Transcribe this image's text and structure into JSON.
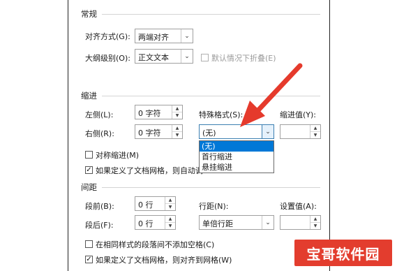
{
  "general": {
    "title": "常规",
    "alignment_label": "对齐方式(G):",
    "alignment_value": "两端对齐",
    "outline_label": "大纲级别(O):",
    "outline_value": "正文文本",
    "collapse_label": "默认情况下折叠(E)"
  },
  "indent": {
    "title": "缩进",
    "left_label": "左侧(L):",
    "left_value": "0 字符",
    "right_label": "右侧(R):",
    "right_value": "0 字符",
    "special_label": "特殊格式(S):",
    "special_value": "(无)",
    "indent_by_label": "缩进值(Y):",
    "indent_by_value": "",
    "mirror_label": "对称缩进(M)",
    "grid_label": "如果定义了文档网格，则自动调",
    "special_options": [
      "(无)",
      "首行缩进",
      "悬挂缩进"
    ]
  },
  "spacing": {
    "title": "间距",
    "before_label": "段前(B):",
    "before_value": "0 行",
    "after_label": "段后(F):",
    "after_value": "0 行",
    "line_spacing_label": "行距(N):",
    "line_spacing_value": "单倍行距",
    "at_label": "设置值(A):",
    "at_value": "",
    "no_space_label": "在相同样式的段落间不添加空格(C)",
    "snap_grid_label": "如果定义了文档网格，则对齐到网格(W)"
  },
  "watermark": "宝哥软件园",
  "colors": {
    "arrow": "#e53a2c",
    "selection": "#0078d7",
    "watermark_bg": "#e33d2e"
  }
}
